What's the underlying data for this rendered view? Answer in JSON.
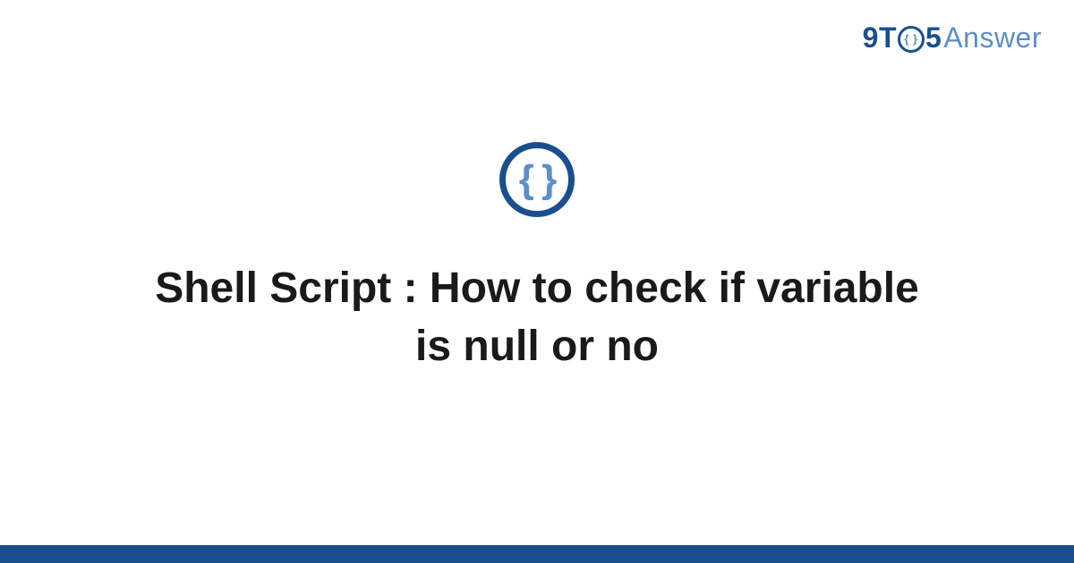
{
  "logo": {
    "part1": "9T",
    "circle_inner": "{ }",
    "part2": "5",
    "part3": "Answer"
  },
  "icon": {
    "glyph": "{ }"
  },
  "title": "Shell Script : How to check if variable is null or no",
  "colors": {
    "brand_dark": "#1a4f8f",
    "brand_light": "#5a8fc9"
  }
}
